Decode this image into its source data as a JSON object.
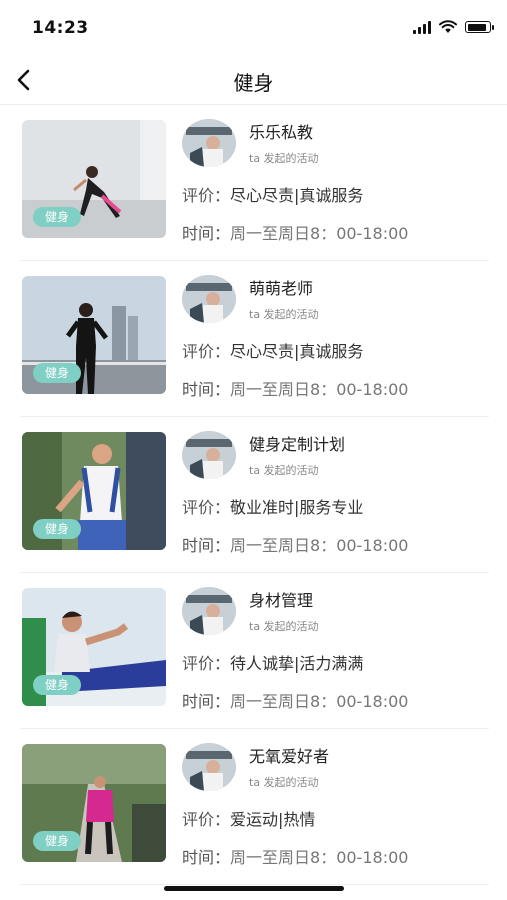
{
  "status_bar": {
    "time": "14:23"
  },
  "nav": {
    "title": "健身"
  },
  "list_labels": {
    "rating_prefix": "评价：",
    "time_prefix": "时间："
  },
  "items": [
    {
      "tag": "健身",
      "name": "乐乐私教",
      "subtitle": "ta 发起的活动",
      "rating": "尽心尽责|真诚服务",
      "time": "周一至周日8：00-18:00"
    },
    {
      "tag": "健身",
      "name": "萌萌老师",
      "subtitle": "ta 发起的活动",
      "rating": "尽心尽责|真诚服务",
      "time": "周一至周日8：00-18:00"
    },
    {
      "tag": "健身",
      "name": "健身定制计划",
      "subtitle": "ta 发起的活动",
      "rating": "敬业准时|服务专业",
      "time": "周一至周日8：00-18:00"
    },
    {
      "tag": "健身",
      "name": "身材管理",
      "subtitle": "ta 发起的活动",
      "rating": "待人诚挚|活力满满",
      "time": "周一至周日8：00-18:00"
    },
    {
      "tag": "健身",
      "name": "无氧爱好者",
      "subtitle": "ta 发起的活动",
      "rating": "爱运动|热情",
      "time": "周一至周日8：00-18:00"
    }
  ],
  "colors": {
    "tag_bg": "#7fcfc4",
    "divider": "#efefef"
  }
}
